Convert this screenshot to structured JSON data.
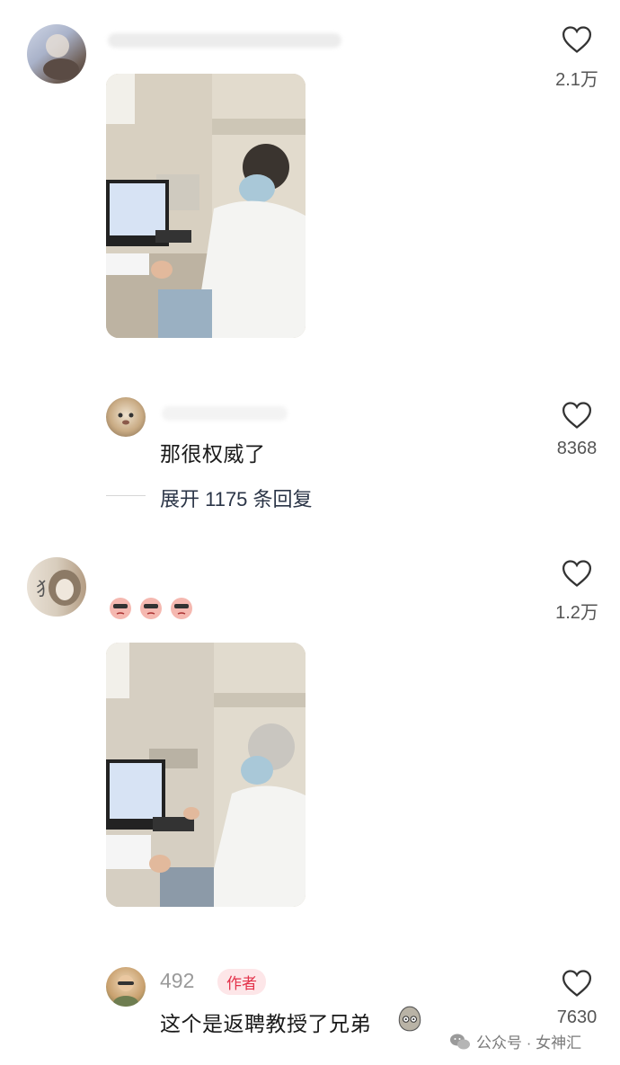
{
  "comments": [
    {
      "likes": "2.1万"
    },
    {
      "text": "那很权威了",
      "likes": "8368",
      "expand": "展开 1175 条回复"
    },
    {
      "likes": "1.2万"
    },
    {
      "username": "492",
      "badge": "作者",
      "text": "这个是返聘教授了兄弟",
      "likes": "7630"
    }
  ],
  "watermark": {
    "text": "公众号 · 女神汇"
  },
  "colors": {
    "like_icon": "#333333",
    "author_badge": "#e3324a",
    "author_badge_bg": "#fde6e8"
  }
}
